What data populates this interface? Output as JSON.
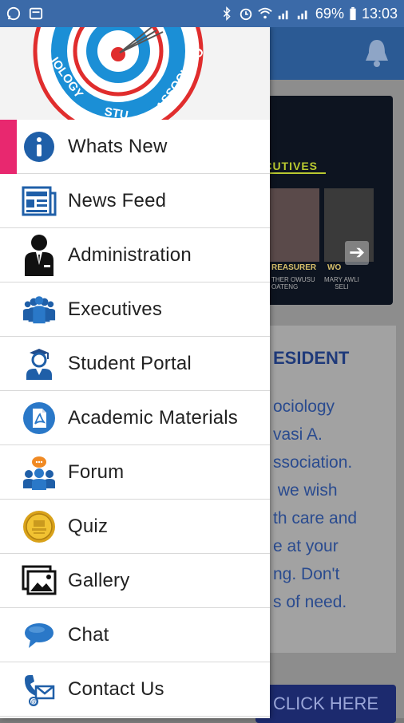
{
  "status_bar": {
    "battery": "69%",
    "time": "13:03"
  },
  "background": {
    "exec_title": "ECUTIVES",
    "exec_1_label": "REASURER",
    "exec_1_sub": "THER OWUSU\nOATENG",
    "exec_2_label": "WO",
    "exec_2_sub": "MARY AWLI\nSELI",
    "president_title": "ESIDENT",
    "president_text": "ociology\nvasi A.\nssociation.\n we wish\nth care and\ne at your\nng. Don't\ns of need.",
    "click_here": "CLICK HERE"
  },
  "drawer": {
    "logo_text_1": "IOLOGY",
    "logo_text_2": "STU",
    "logo_text_3": "ASSOCIATIO",
    "items": [
      {
        "label": "Whats New",
        "icon": "info-icon"
      },
      {
        "label": "News Feed",
        "icon": "newspaper-icon"
      },
      {
        "label": "Administration",
        "icon": "admin-icon"
      },
      {
        "label": "Executives",
        "icon": "group-icon"
      },
      {
        "label": "Student Portal",
        "icon": "graduate-icon"
      },
      {
        "label": "Academic Materials",
        "icon": "pdf-icon"
      },
      {
        "label": "Forum",
        "icon": "forum-icon"
      },
      {
        "label": "Quiz",
        "icon": "coin-icon"
      },
      {
        "label": "Gallery",
        "icon": "gallery-icon"
      },
      {
        "label": "Chat",
        "icon": "chat-icon"
      },
      {
        "label": "Contact Us",
        "icon": "contact-icon"
      }
    ]
  },
  "colors": {
    "status_bar": "#3b6aa8",
    "active_marker": "#e8286f",
    "icon_blue": "#1f5fa8"
  }
}
